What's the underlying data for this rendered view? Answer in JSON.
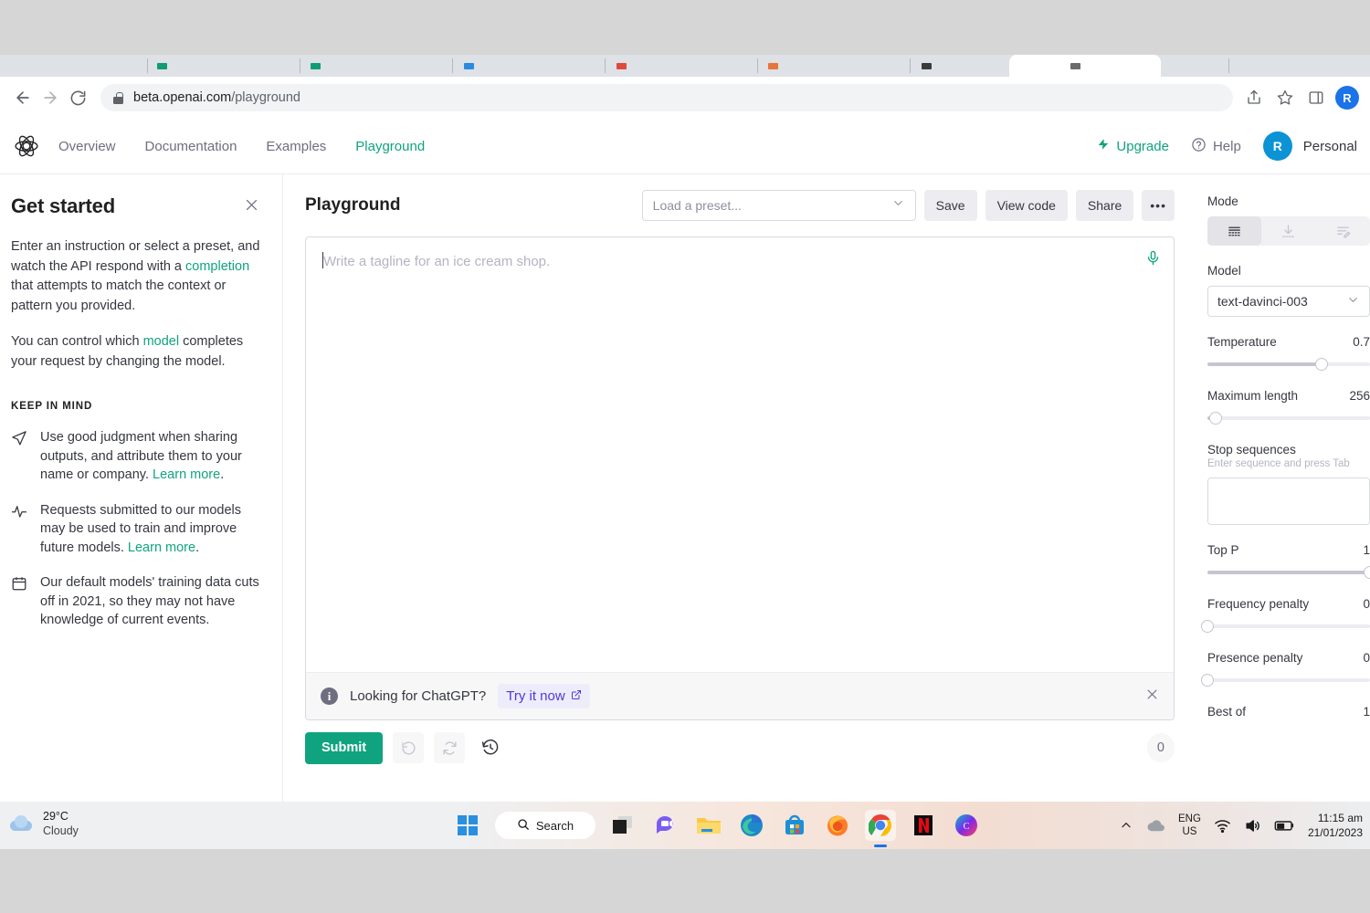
{
  "browser": {
    "url_domain": "beta.openai.com",
    "url_path": "/playground",
    "profile_initial": "R"
  },
  "topnav": {
    "links": [
      {
        "label": "Overview",
        "active": false
      },
      {
        "label": "Documentation",
        "active": false
      },
      {
        "label": "Examples",
        "active": false
      },
      {
        "label": "Playground",
        "active": true
      }
    ],
    "upgrade": "Upgrade",
    "help": "Help",
    "account_initial": "R",
    "account_name": "Personal"
  },
  "sidebar": {
    "title": "Get started",
    "paragraph1_a": "Enter an instruction or select a preset, and watch the API respond with a ",
    "paragraph1_link": "completion",
    "paragraph1_b": " that attempts to match the context or pattern you provided.",
    "paragraph2_a": "You can control which ",
    "paragraph2_link": "model",
    "paragraph2_b": " completes your request by changing the model.",
    "keep_in_mind_heading": "KEEP IN MIND",
    "items": [
      {
        "icon": "send-icon",
        "text_a": "Use good judgment when sharing outputs, and attribute them to your name or company. ",
        "link": "Learn more",
        "text_b": "."
      },
      {
        "icon": "activity-icon",
        "text_a": "Requests submitted to our models may be used to train and improve future models. ",
        "link": "Learn more",
        "text_b": "."
      },
      {
        "icon": "calendar-icon",
        "text_a": "Our default models' training data cuts off in 2021, so they may not have knowledge of current events.",
        "link": "",
        "text_b": ""
      }
    ]
  },
  "main": {
    "page_title": "Playground",
    "preset_placeholder": "Load a preset...",
    "save_label": "Save",
    "view_code_label": "View code",
    "share_label": "Share",
    "more_label": "•••",
    "prompt_placeholder": "Write a tagline for an ice cream shop.",
    "prompt_value": "",
    "banner_text": "Looking for ChatGPT?",
    "banner_cta": "Try it now",
    "submit_label": "Submit",
    "token_count": "0"
  },
  "settings": {
    "mode_label": "Mode",
    "mode_selected": "complete",
    "model_label": "Model",
    "model_value": "text-davinci-003",
    "temperature_label": "Temperature",
    "temperature_value": "0.7",
    "temperature_pct": 70,
    "max_length_label": "Maximum length",
    "max_length_value": "256",
    "max_length_pct": 5,
    "stop_label": "Stop sequences",
    "stop_hint": "Enter sequence and press Tab",
    "stop_value": "",
    "top_p_label": "Top P",
    "top_p_value": "1",
    "top_p_pct": 100,
    "freq_label": "Frequency penalty",
    "freq_value": "0",
    "freq_pct": 0,
    "pres_label": "Presence penalty",
    "pres_value": "0",
    "pres_pct": 0,
    "best_of_label": "Best of",
    "best_of_value": "1"
  },
  "taskbar": {
    "weather_temp": "29°C",
    "weather_cond": "Cloudy",
    "search_label": "Search",
    "lang_line1": "ENG",
    "lang_line2": "US",
    "time": "11:15 am",
    "date": "21/01/2023"
  },
  "colors": {
    "accent_green": "#10a37f",
    "chatgpt_purple": "#5436da",
    "chrome_blue": "#1a73e8"
  }
}
